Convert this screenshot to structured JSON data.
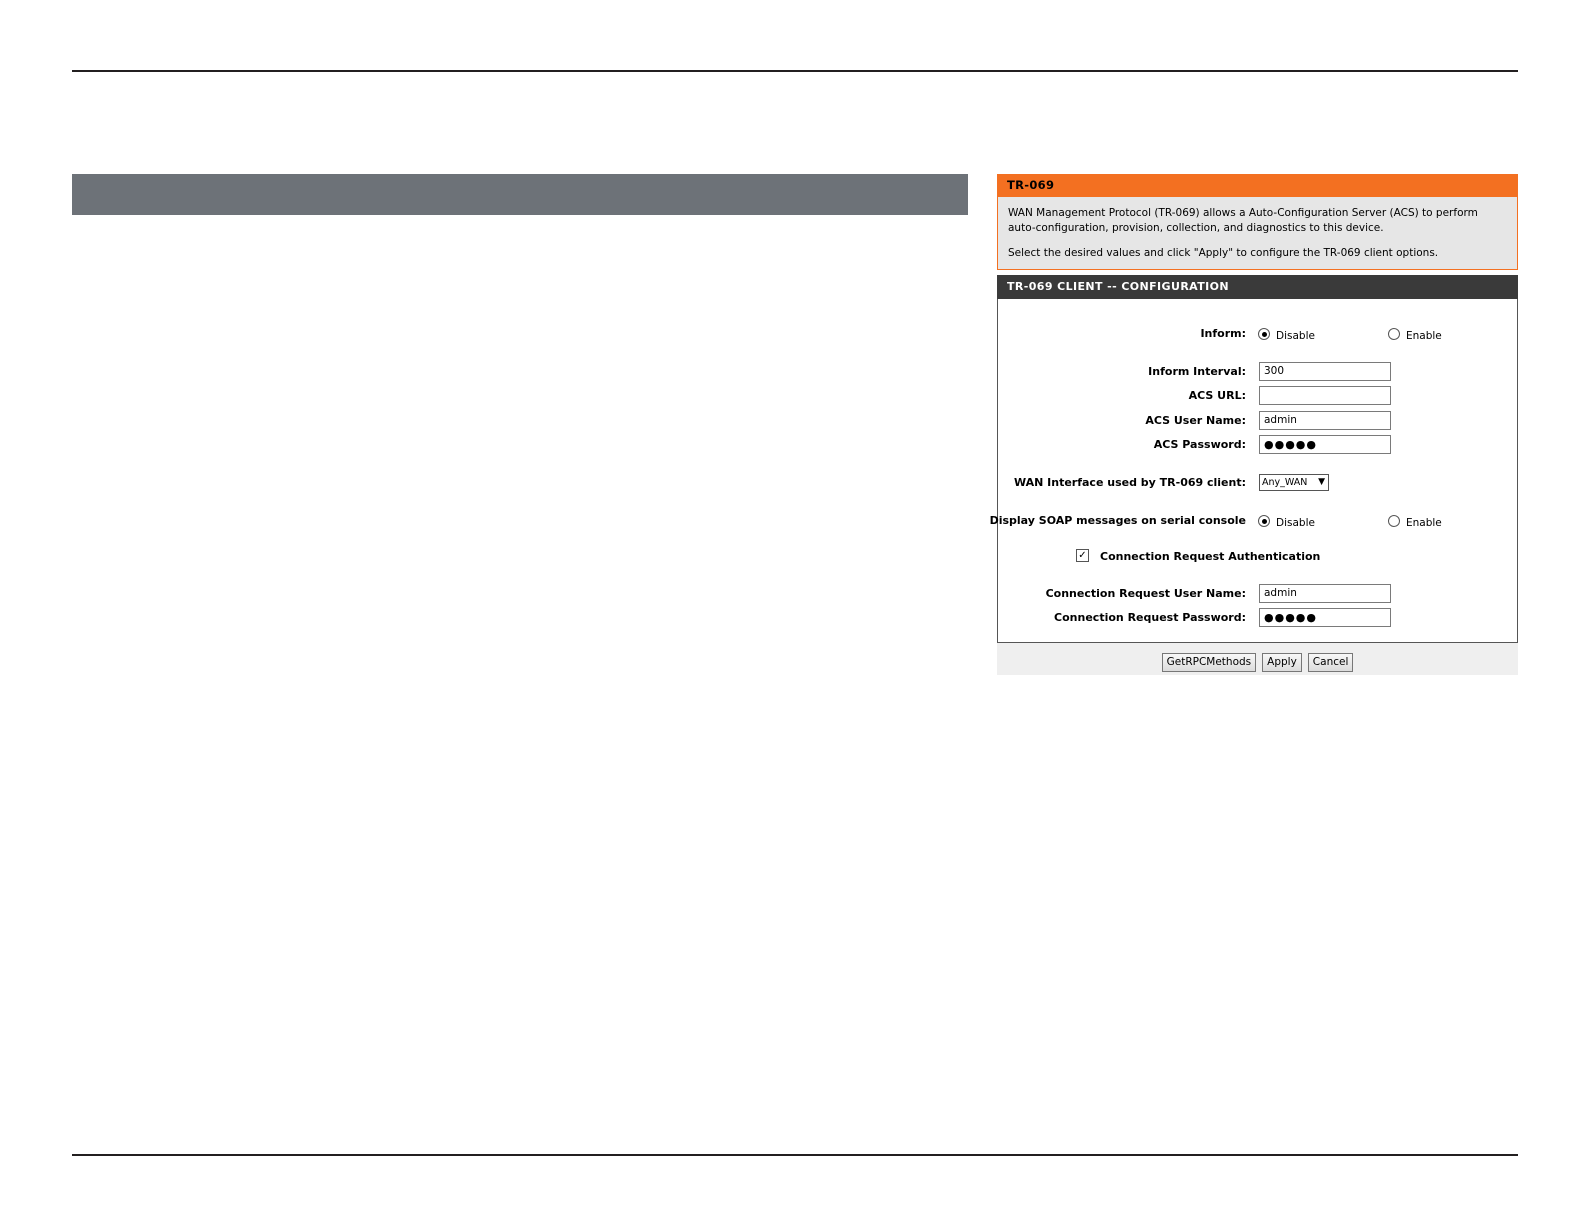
{
  "tr069": {
    "title": "TR-069",
    "description": "WAN Management Protocol (TR-069) allows a Auto-Configuration Server (ACS) to perform auto-configuration, provision, collection, and diagnostics to this device.",
    "instruction": "Select the desired values and click \"Apply\" to configure the TR-069 client options."
  },
  "config": {
    "title": "TR-069 CLIENT -- CONFIGURATION",
    "inform": {
      "label": "Inform:",
      "options": [
        "Disable",
        "Enable"
      ],
      "selected": "Disable"
    },
    "inform_interval": {
      "label": "Inform Interval:",
      "value": "300"
    },
    "acs_url": {
      "label": "ACS URL:",
      "value": ""
    },
    "acs_user_name": {
      "label": "ACS User Name:",
      "value": "admin"
    },
    "acs_password": {
      "label": "ACS Password:",
      "value": "●●●●●"
    },
    "wan_interface": {
      "label": "WAN Interface used by TR-069 client:",
      "value": "Any_WAN"
    },
    "soap": {
      "label": "Display SOAP messages on serial console",
      "options": [
        "Disable",
        "Enable"
      ],
      "selected": "Disable"
    },
    "conn_req_auth": {
      "label": "Connection Request Authentication",
      "checked": true
    },
    "conn_req_user_name": {
      "label": "Connection Request User Name:",
      "value": "admin"
    },
    "conn_req_password": {
      "label": "Connection Request Password:",
      "value": "●●●●●"
    }
  },
  "buttons": {
    "getrpc": "GetRPCMethods",
    "apply": "Apply",
    "cancel": "Cancel"
  }
}
